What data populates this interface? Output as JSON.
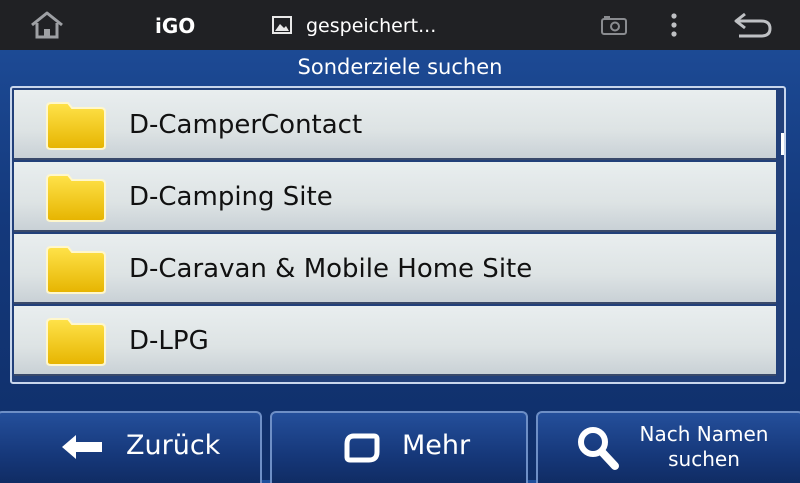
{
  "statusbar": {
    "app_name": "iGO",
    "notification_text": "gespeichert...",
    "icons": [
      "home-icon",
      "image-icon",
      "screenshot-icon",
      "overflow-menu-icon",
      "back-arrow-icon"
    ]
  },
  "screen": {
    "title": "Sonderziele suchen"
  },
  "list": {
    "items": [
      {
        "label": "D-CamperContact",
        "icon": "folder-icon"
      },
      {
        "label": "D-Camping Site",
        "icon": "folder-icon"
      },
      {
        "label": "D-Caravan & Mobile Home Site",
        "icon": "folder-icon"
      },
      {
        "label": "D-LPG",
        "icon": "folder-icon"
      }
    ]
  },
  "buttons": {
    "back_label": "Zurück",
    "more_label": "Mehr",
    "search_line1": "Nach Namen",
    "search_line2": "suchen"
  },
  "colors": {
    "background": "#14397c",
    "statusbar": "#202124",
    "row": "#e2e7e8",
    "folder": "#f2c200"
  }
}
